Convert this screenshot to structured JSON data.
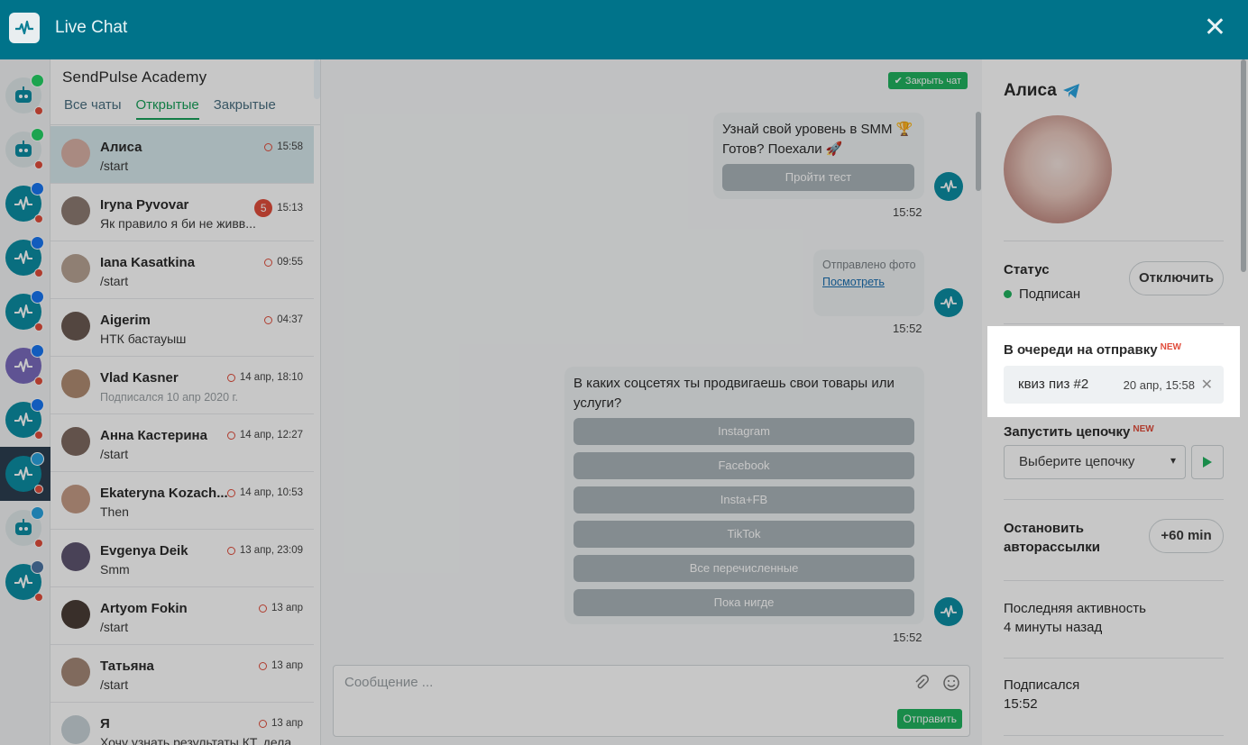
{
  "header": {
    "title": "Live Chat",
    "close_glyph": "✕"
  },
  "chat_list": {
    "title": "SendPulse Academy",
    "tabs": [
      "Все чаты",
      "Открытые",
      "Закрытые"
    ],
    "active_tab": "Открытые",
    "items": [
      {
        "name": "Алиса",
        "preview": "/start",
        "time": "15:58"
      },
      {
        "name": "Iryna Pyvovar",
        "preview": "Як правило я би не живв...",
        "time": "15:13",
        "unread": "5"
      },
      {
        "name": "Iana Kasatkina",
        "preview": "/start",
        "time": "09:55"
      },
      {
        "name": "Aigerim",
        "preview": "НТК бастауыш",
        "time": "04:37"
      },
      {
        "name": "Vlad Kasner",
        "preview": "Подписался 10 апр 2020 г.",
        "time": "14 апр, 18:10"
      },
      {
        "name": "Анна Кастерина",
        "preview": "/start",
        "time": "14 апр, 12:27"
      },
      {
        "name": "Ekateryna Kozach...",
        "preview": "Then",
        "time": "14 апр, 10:53"
      },
      {
        "name": "Evgenya Deik",
        "preview": "Smm",
        "time": "13 апр, 23:09"
      },
      {
        "name": "Artyom Fokin",
        "preview": "/start",
        "time": "13 апр"
      },
      {
        "name": "Татьяна",
        "preview": "/start",
        "time": "13 апр"
      },
      {
        "name": "Я",
        "preview": "Хочу узнать результаты КТ, дела...",
        "time": "13 апр"
      }
    ]
  },
  "chat": {
    "close_chat_label": "Закрыть чат",
    "msg1": {
      "line1": "Узнай свой уровень в SMM 🏆",
      "line2": "Готов? Поехали 🚀",
      "button": "Пройти тест",
      "time": "15:52"
    },
    "msg2": {
      "label": "Отправлено фото",
      "link": "Посмотреть",
      "time": "15:52"
    },
    "msg3": {
      "text": "В каких соцсетях ты продвигаешь свои товары или услуги?",
      "buttons": [
        "Instagram",
        "Facebook",
        "Insta+FB",
        "TikTok",
        "Все перечисленные",
        "Пока нигде"
      ],
      "time": "15:52"
    },
    "composer": {
      "placeholder": "Сообщение ...",
      "send": "Отправить"
    }
  },
  "profile": {
    "name": "Алиса",
    "status_label": "Статус",
    "status_value": "Подписан",
    "unsubscribe": "Отключить",
    "queue_title": "В очереди на отправку",
    "new_tag": "NEW",
    "queue_item": {
      "name": "квиз пиз #2",
      "date": "20 апр, 15:58"
    },
    "chain_title": "Запустить цепочку",
    "chain_select": "Выберите цепочку",
    "stop_title_1": "Остановить",
    "stop_title_2": "авторассылки",
    "stop_button": "+60 min",
    "last_activity_label": "Последняя активность",
    "last_activity_value": "4 минуты назад",
    "subscribed_label": "Подписался",
    "subscribed_value": "15:52"
  },
  "colors": {
    "header": "#00738a",
    "accent_green": "#19a05a",
    "alert_red": "#e14d3c"
  }
}
